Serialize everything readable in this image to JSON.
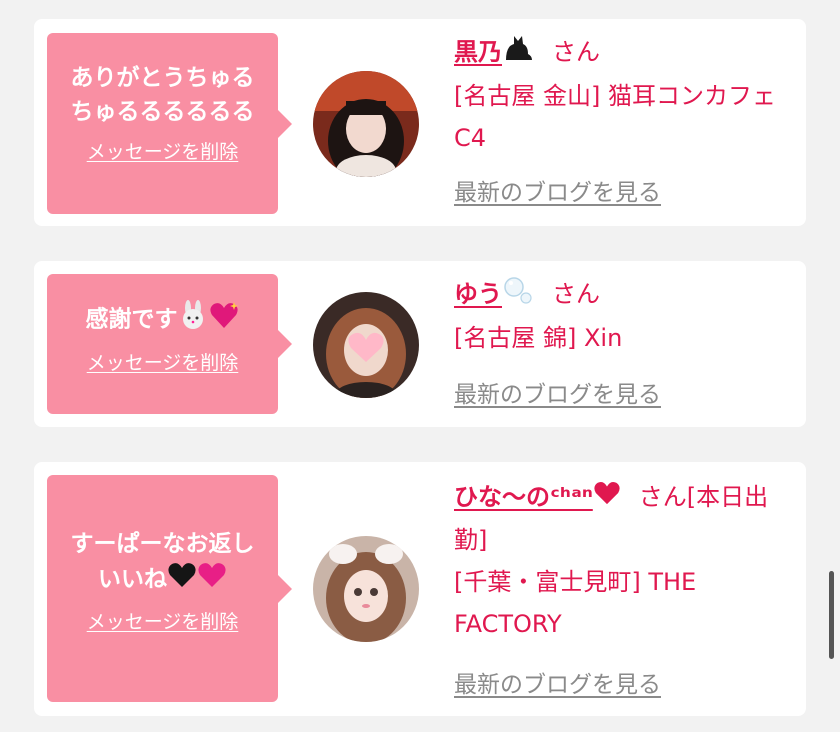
{
  "items": [
    {
      "message_line1": "ありがとうちゅる",
      "message_line2": "ちゅるるるるるる",
      "delete_label": "メッセージを削除",
      "name": "黒乃",
      "name_emoji": "cat-emoji",
      "honorific": "さん",
      "shop": "[名古屋 金山] 猫耳コンカフェ C4",
      "blog_label": "最新のブログを見る"
    },
    {
      "message_line1": "感謝です",
      "message_emojis": [
        "rabbit-emoji",
        "sparkle-heart-emoji"
      ],
      "delete_label": "メッセージを削除",
      "name": "ゆう",
      "name_emoji": "bubbles-emoji",
      "honorific": "さん",
      "shop": "[名古屋 錦] Xin",
      "blog_label": "最新のブログを見る"
    },
    {
      "message_line1": "すーぱーなお返し",
      "message_line2": "いいね",
      "message_emojis": [
        "black-heart-emoji",
        "pink-heart-emoji"
      ],
      "delete_label": "メッセージを削除",
      "name": "ひな〜のᶜʰᵃⁿ",
      "name_emoji": "red-heart-emoji",
      "honorific": "さん[本日出勤]",
      "shop": "[千葉・富士見町] THE FACTORY",
      "blog_label": "最新のブログを見る"
    }
  ],
  "colors": {
    "bubble": "#f98fa3",
    "accent": "#e0184f",
    "background": "#f2f2f2",
    "link_gray": "#8a8a8a"
  }
}
